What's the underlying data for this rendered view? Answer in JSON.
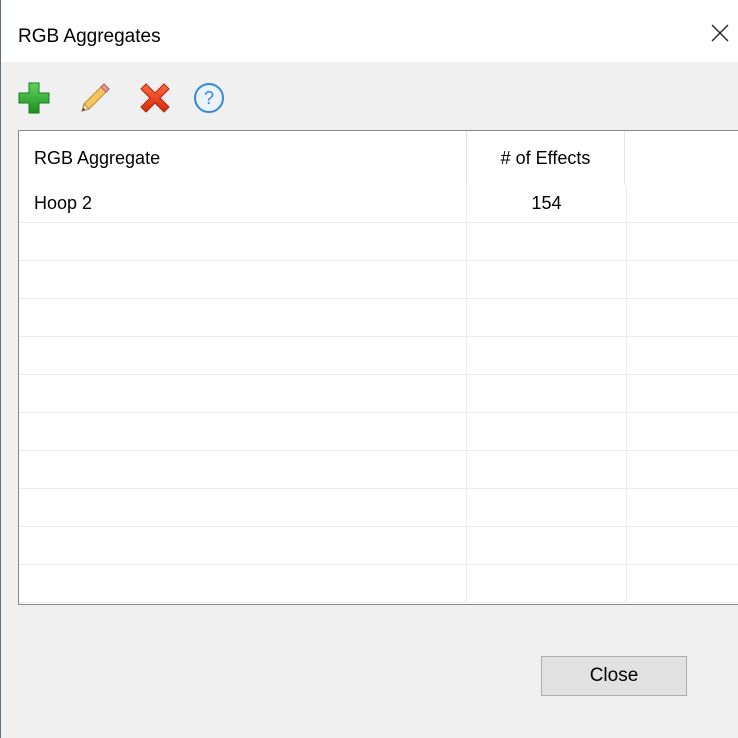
{
  "window": {
    "title": "RGB Aggregates"
  },
  "toolbar": {
    "buttons": [
      {
        "icon": "plus-icon",
        "color": "#2ea62e"
      },
      {
        "icon": "pencil-icon",
        "color": "#f0b44a"
      },
      {
        "icon": "delete-x-icon",
        "color": "#e8421c"
      },
      {
        "icon": "help-icon",
        "color": "#3a86d4"
      }
    ]
  },
  "grid": {
    "columns": [
      "RGB Aggregate",
      "# of Effects"
    ],
    "rows": [
      {
        "name": "Hoop 2",
        "effects": "154"
      },
      {
        "name": "",
        "effects": ""
      },
      {
        "name": "",
        "effects": ""
      },
      {
        "name": "",
        "effects": ""
      },
      {
        "name": "",
        "effects": ""
      },
      {
        "name": "",
        "effects": ""
      },
      {
        "name": "",
        "effects": ""
      },
      {
        "name": "",
        "effects": ""
      },
      {
        "name": "",
        "effects": ""
      },
      {
        "name": "",
        "effects": ""
      },
      {
        "name": "",
        "effects": ""
      }
    ]
  },
  "footer": {
    "close_label": "Close"
  }
}
